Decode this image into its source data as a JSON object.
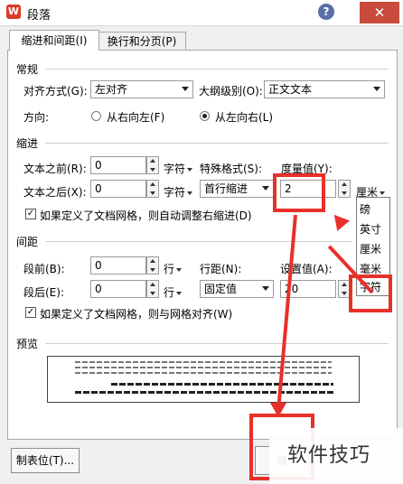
{
  "window": {
    "title": "段落",
    "app_icon": "W",
    "help_icon": "?",
    "close_icon": "✕"
  },
  "tabs": [
    {
      "label": "缩进和间距(I)",
      "active": true
    },
    {
      "label": "换行和分页(P)",
      "active": false
    }
  ],
  "general": {
    "section": "常规",
    "align_label": "对齐方式(G):",
    "align_value": "左对齐",
    "outline_label": "大纲级别(O):",
    "outline_value": "正文文本",
    "direction_label": "方向:",
    "rtl_label": "从右向左(F)",
    "ltr_label": "从左向右(L)",
    "direction_selected": "ltr"
  },
  "indent": {
    "section": "缩进",
    "before_label": "文本之前(R):",
    "before_value": "0",
    "before_unit": "字符",
    "after_label": "文本之后(X):",
    "after_value": "0",
    "after_unit": "字符",
    "special_label": "特殊格式(S):",
    "special_value": "首行缩进",
    "measure_label": "度量值(Y):",
    "measure_value": "2",
    "measure_unit": "厘米",
    "auto_adjust_label": "如果定义了文档网格，则自动调整右缩进(D)",
    "auto_adjust_checked": true
  },
  "unit_dropdown": {
    "options": [
      "磅",
      "英寸",
      "厘米",
      "毫米",
      "字符"
    ],
    "highlighted": "字符"
  },
  "spacing": {
    "section": "间距",
    "before_label": "段前(B):",
    "before_value": "0",
    "before_unit": "行",
    "after_label": "段后(E):",
    "after_value": "0",
    "after_unit": "行",
    "line_label": "行距(N):",
    "line_value": "固定值",
    "set_label": "设置值(A):",
    "set_value": "20",
    "grid_label": "如果定义了文档网格，则与网格对齐(W)",
    "grid_checked": true
  },
  "preview": {
    "section": "预览"
  },
  "buttons": {
    "tabs_label": "制表位(T)...",
    "ok_label": "确"
  },
  "watermark": {
    "text": "软件技巧"
  },
  "annotations": {
    "color": "#e8302a"
  }
}
